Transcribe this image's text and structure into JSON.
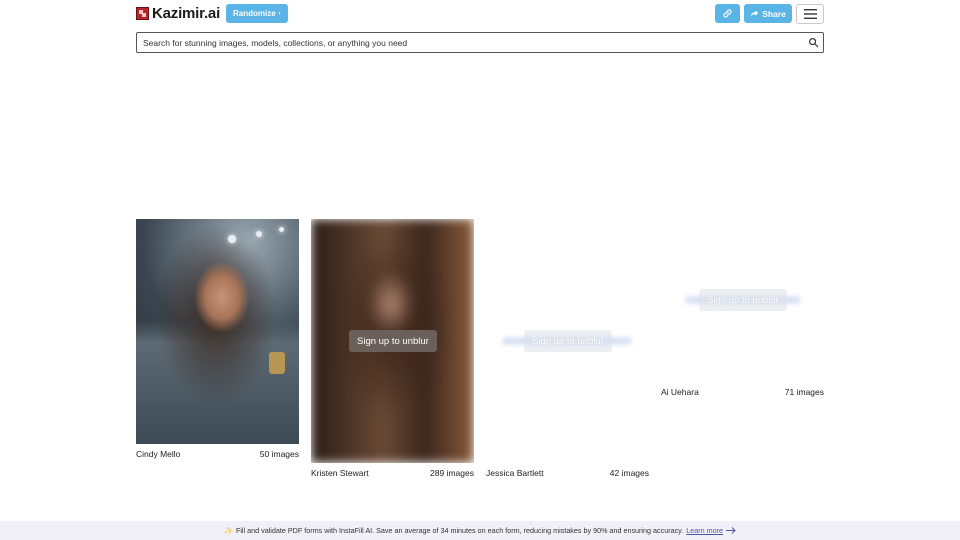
{
  "header": {
    "logo_text": "Kazimir.ai",
    "randomize_label": "Randomize",
    "share_label": "Share",
    "accent_color": "#5ab4e6"
  },
  "search": {
    "placeholder": "Search for stunning images, models, collections, or anything you need",
    "value": ""
  },
  "cards": [
    {
      "name": "Cindy Mello",
      "count": "50 images",
      "blurred": false
    },
    {
      "name": "Kristen Stewart",
      "count": "289 images",
      "blurred": true,
      "overlay": "Sign up to unblur"
    },
    {
      "name": "Jessica Bartlett",
      "count": "42 images",
      "blurred": true,
      "overlay": "Sign up to unblur"
    },
    {
      "name": "Ai Uehara",
      "count": "71 images",
      "blurred": true,
      "overlay": "Sign up to unblur"
    }
  ],
  "banner": {
    "emoji": "✨",
    "text": "Fill and validate PDF forms with InstaFill AI. Save an average of 34 minutes on each form, reducing mistakes by 90% and ensuring accuracy.",
    "link_text": "Learn more"
  },
  "icons": [
    "logo-icon",
    "caret-right-icon",
    "link-icon",
    "share-arrow-icon",
    "hamburger-menu-icon",
    "search-icon",
    "arrow-right-icon"
  ]
}
